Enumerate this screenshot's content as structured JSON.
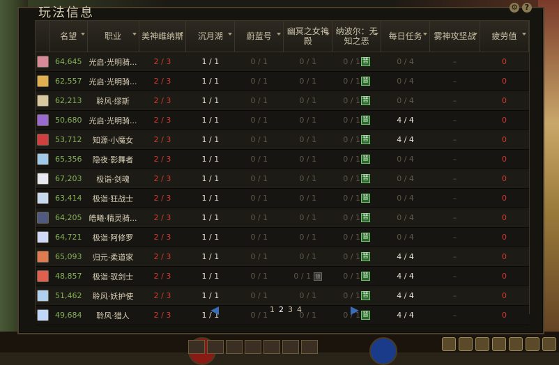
{
  "panel": {
    "title": "玩法信息"
  },
  "header": [
    {
      "label": "",
      "sortable": false
    },
    {
      "label": "名望",
      "sortable": true
    },
    {
      "label": "职业",
      "sortable": true
    },
    {
      "label": "美神维纳斯",
      "sortable": true
    },
    {
      "label": "沉月湖",
      "sortable": true
    },
    {
      "label": "蔚蓝号",
      "sortable": true
    },
    {
      "label": "幽冥之女神殿",
      "sortable": true
    },
    {
      "label": "纳波尔：无知之恶",
      "sortable": true
    },
    {
      "label": "每日任务",
      "sortable": true
    },
    {
      "label": "雾神攻坚战",
      "sortable": true
    },
    {
      "label": "疲劳值",
      "sortable": true
    }
  ],
  "rows": [
    {
      "avatar": "#d88a9a",
      "renown": "64,645",
      "job": "光启·光明骑...",
      "venus": "2 / 3",
      "lake": "1 / 1",
      "azure": "0 / 1",
      "nether": "0 / 1",
      "nabol": "0 / 1",
      "daily": "0 / 4",
      "fog": "–",
      "fatigue": "0",
      "daily_done": false,
      "locked": false
    },
    {
      "avatar": "#e0b050",
      "renown": "62,557",
      "job": "光启·光明骑...",
      "venus": "2 / 3",
      "lake": "1 / 1",
      "azure": "0 / 1",
      "nether": "0 / 1",
      "nabol": "0 / 1",
      "daily": "0 / 4",
      "fog": "–",
      "fatigue": "0",
      "daily_done": false,
      "locked": false
    },
    {
      "avatar": "#d8c8a0",
      "renown": "62,213",
      "job": "聆风·缪斯",
      "venus": "2 / 3",
      "lake": "1 / 1",
      "azure": "0 / 1",
      "nether": "0 / 1",
      "nabol": "0 / 1",
      "daily": "0 / 4",
      "fog": "–",
      "fatigue": "0",
      "daily_done": false,
      "locked": false
    },
    {
      "avatar": "#9a6ad0",
      "renown": "50,680",
      "job": "光启·光明骑...",
      "venus": "2 / 3",
      "lake": "1 / 1",
      "azure": "0 / 1",
      "nether": "0 / 1",
      "nabol": "0 / 1",
      "daily": "4 / 4",
      "fog": "–",
      "fatigue": "0",
      "daily_done": true,
      "locked": false
    },
    {
      "avatar": "#d04040",
      "renown": "53,712",
      "job": "知源·小魔女",
      "venus": "2 / 3",
      "lake": "1 / 1",
      "azure": "0 / 1",
      "nether": "0 / 1",
      "nabol": "0 / 1",
      "daily": "4 / 4",
      "fog": "–",
      "fatigue": "0",
      "daily_done": true,
      "locked": false
    },
    {
      "avatar": "#a0c8e8",
      "renown": "65,356",
      "job": "隐夜·影舞者",
      "venus": "2 / 3",
      "lake": "1 / 1",
      "azure": "0 / 1",
      "nether": "0 / 1",
      "nabol": "0 / 1",
      "daily": "0 / 4",
      "fog": "–",
      "fatigue": "0",
      "daily_done": false,
      "locked": false
    },
    {
      "avatar": "#e8e8f0",
      "renown": "67,203",
      "job": "极诣·剑魂",
      "venus": "2 / 3",
      "lake": "1 / 1",
      "azure": "0 / 1",
      "nether": "0 / 1",
      "nabol": "0 / 1",
      "daily": "0 / 4",
      "fog": "–",
      "fatigue": "0",
      "daily_done": false,
      "locked": false
    },
    {
      "avatar": "#c8d8f0",
      "renown": "63,414",
      "job": "极诣·狂战士",
      "venus": "2 / 3",
      "lake": "1 / 1",
      "azure": "0 / 1",
      "nether": "0 / 1",
      "nabol": "0 / 1",
      "daily": "0 / 4",
      "fog": "–",
      "fatigue": "0",
      "daily_done": false,
      "locked": false
    },
    {
      "avatar": "#505a80",
      "renown": "64,205",
      "job": "皓曦·精灵骑...",
      "venus": "2 / 3",
      "lake": "1 / 1",
      "azure": "0 / 1",
      "nether": "0 / 1",
      "nabol": "0 / 1",
      "daily": "0 / 4",
      "fog": "–",
      "fatigue": "0",
      "daily_done": false,
      "locked": false
    },
    {
      "avatar": "#d0d8f8",
      "renown": "64,721",
      "job": "极诣·阿修罗",
      "venus": "2 / 3",
      "lake": "1 / 1",
      "azure": "0 / 1",
      "nether": "0 / 1",
      "nabol": "0 / 1",
      "daily": "0 / 4",
      "fog": "–",
      "fatigue": "0",
      "daily_done": false,
      "locked": false
    },
    {
      "avatar": "#e07a50",
      "renown": "65,093",
      "job": "归元·柔道家",
      "venus": "2 / 3",
      "lake": "1 / 1",
      "azure": "0 / 1",
      "nether": "0 / 1",
      "nabol": "0 / 1",
      "daily": "4 / 4",
      "fog": "–",
      "fatigue": "0",
      "daily_done": true,
      "locked": false
    },
    {
      "avatar": "#e06050",
      "renown": "48,857",
      "job": "极诣·驭剑士",
      "venus": "2 / 3",
      "lake": "1 / 1",
      "azure": "0 / 1",
      "nether": "0 / 1",
      "nabol": "0 / 1",
      "daily": "4 / 4",
      "fog": "–",
      "fatigue": "0",
      "daily_done": true,
      "locked": true
    },
    {
      "avatar": "#b0d0f0",
      "renown": "51,462",
      "job": "聆风·妖护使",
      "venus": "2 / 3",
      "lake": "1 / 1",
      "azure": "0 / 1",
      "nether": "0 / 1",
      "nabol": "0 / 1",
      "daily": "4 / 4",
      "fog": "–",
      "fatigue": "0",
      "daily_done": true,
      "locked": false
    },
    {
      "avatar": "#c0d8f8",
      "renown": "49,684",
      "job": "聆风·猎人",
      "venus": "2 / 3",
      "lake": "1 / 1",
      "azure": "0 / 1",
      "nether": "0 / 1",
      "nabol": "0 / 1",
      "daily": "4 / 4",
      "fog": "–",
      "fatigue": "0",
      "daily_done": true,
      "locked": false
    }
  ],
  "badge": {
    "qi": "晋",
    "lock": "锁"
  },
  "pager": {
    "pages": [
      "1",
      "2",
      "3",
      "4"
    ],
    "current": "2"
  },
  "colors": {
    "renown": "#86b05a",
    "warn": "#d23b32",
    "accent": "#3a6db8"
  }
}
